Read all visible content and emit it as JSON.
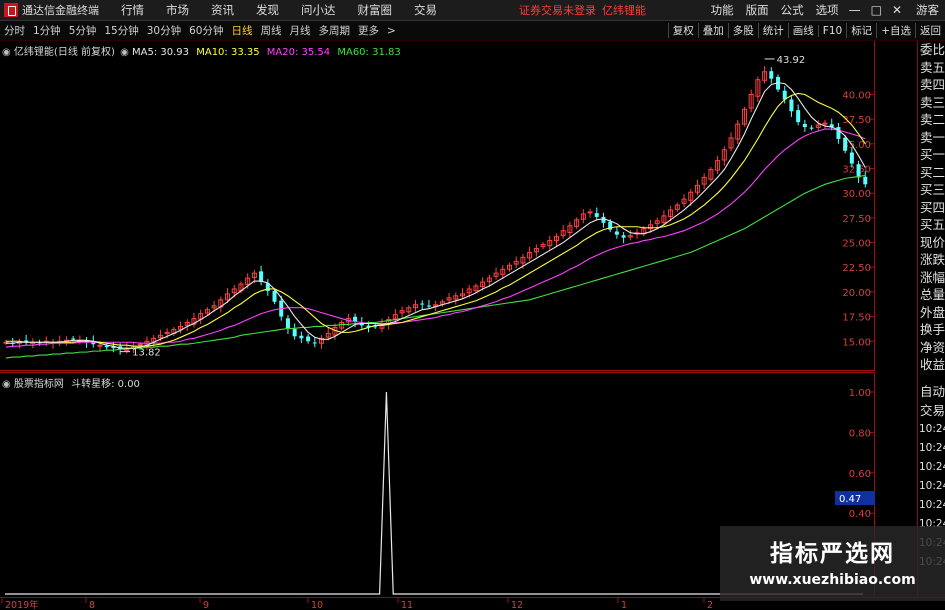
{
  "menubar": {
    "app_title": "通达信金融终端",
    "menus": [
      "行情",
      "市场",
      "资讯",
      "发现",
      "问小达",
      "财富圈",
      "交易"
    ],
    "status_text": "证券交易未登录",
    "stock_name": "亿纬锂能",
    "right_items": [
      "功能",
      "版面",
      "公式",
      "选项"
    ],
    "user": "游客"
  },
  "toolbar": {
    "timeframes": [
      "分时",
      "1分钟",
      "5分钟",
      "15分钟",
      "30分钟",
      "60分钟",
      "日线",
      "周线",
      "月线",
      "多周期",
      "更多"
    ],
    "active": "日线",
    "buttons": [
      "复权",
      "叠加",
      "多股",
      "统计",
      "画线",
      "F10",
      "标记",
      "+自选",
      "返回"
    ]
  },
  "main_legend": {
    "title": "亿纬锂能(日线 前复权)",
    "ma5": "MA5: 30.93",
    "ma10": "MA10: 33.35",
    "ma20": "MA20: 35.54",
    "ma60": "MA60: 31.83"
  },
  "sub_legend": {
    "title": "股票指标网",
    "indicator": "斗转星移: 0.00"
  },
  "right_panel": {
    "items": [
      "委比",
      "卖五",
      "卖四",
      "卖三",
      "卖二",
      "卖一",
      "买一",
      "买二",
      "买三",
      "买四",
      "买五",
      "现价",
      "涨跌",
      "涨幅",
      "总量",
      "外盘",
      "换手",
      "净资",
      "收益"
    ],
    "trade_items": [
      "自动",
      "交易"
    ],
    "times": [
      "10:24",
      "10:24",
      "10:24",
      "10:24",
      "10:24",
      "10:24",
      "10:24",
      "10:24"
    ]
  },
  "date_axis": [
    "2019年",
    "8",
    "9",
    "10",
    "11",
    "12",
    "1",
    "2"
  ],
  "watermark": {
    "line1": "指标严选网",
    "line2": "www.xuezhibiao.com"
  },
  "colors": {
    "up": "#ff4040",
    "down": "#54ffff",
    "ma5": "#e8e8e8",
    "ma10": "#ffff40",
    "ma20": "#ff40ff",
    "ma60": "#40e040",
    "axis": "#a01010"
  },
  "chart_data": [
    {
      "type": "candlestick",
      "title": "亿纬锂能(日线 前复权)",
      "ylim": [
        13,
        44
      ],
      "yticks": [
        15.0,
        17.5,
        20.0,
        22.5,
        25.0,
        27.5,
        30.0,
        32.5,
        35.0,
        37.5,
        40.0
      ],
      "annotations": [
        {
          "label": "43.92",
          "kind": "high"
        },
        {
          "label": "13.82",
          "kind": "low"
        }
      ],
      "close": [
        14.9,
        14.8,
        14.9,
        14.9,
        14.9,
        14.8,
        15.0,
        14.9,
        15.0,
        15.1,
        15.2,
        15.1,
        14.9,
        14.7,
        14.6,
        14.4,
        14.3,
        14.2,
        14.3,
        14.5,
        14.7,
        15.0,
        15.3,
        15.6,
        15.9,
        16.2,
        16.5,
        16.9,
        17.3,
        17.8,
        18.2,
        18.6,
        19.2,
        19.8,
        20.3,
        20.8,
        21.4,
        21.9,
        21.0,
        20.1,
        19.0,
        17.5,
        16.3,
        15.5,
        15.3,
        15.0,
        14.8,
        15.3,
        15.8,
        16.4,
        16.9,
        17.3,
        17.0,
        16.6,
        16.4,
        16.5,
        16.8,
        17.2,
        17.7,
        18.1,
        18.4,
        18.7,
        18.8,
        18.6,
        18.7,
        19.0,
        19.4,
        19.6,
        19.8,
        20.3,
        20.6,
        21.0,
        21.4,
        21.9,
        22.3,
        22.7,
        23.1,
        23.5,
        24.0,
        24.4,
        24.8,
        25.2,
        25.6,
        26.2,
        26.7,
        27.3,
        27.9,
        28.1,
        27.6,
        27.0,
        26.3,
        25.8,
        25.5,
        25.7,
        26.0,
        26.4,
        26.8,
        27.2,
        27.7,
        28.3,
        28.8,
        29.4,
        30.1,
        30.8,
        31.6,
        32.4,
        33.3,
        34.4,
        35.6,
        37.0,
        38.5,
        40.0,
        41.5,
        42.3,
        41.6,
        40.5,
        39.5,
        38.3,
        37.2,
        36.7,
        36.6,
        36.9,
        37.1,
        36.7,
        35.5,
        34.3,
        33.0,
        31.6,
        30.9
      ],
      "ma5": [
        14.8,
        14.8,
        14.9,
        14.9,
        14.9,
        14.9,
        14.9,
        14.9,
        14.9,
        15.0,
        15.1,
        15.1,
        15.1,
        15.0,
        14.8,
        14.6,
        14.5,
        14.3,
        14.3,
        14.3,
        14.4,
        14.6,
        14.9,
        15.2,
        15.5,
        15.8,
        16.1,
        16.5,
        16.8,
        17.2,
        17.6,
        18.1,
        18.5,
        19.0,
        19.6,
        20.1,
        20.6,
        21.1,
        21.1,
        20.9,
        20.3,
        19.4,
        18.5,
        17.5,
        16.7,
        15.9,
        15.4,
        15.2,
        15.2,
        15.5,
        15.9,
        16.3,
        16.7,
        16.8,
        16.8,
        16.8,
        16.7,
        16.8,
        17.0,
        17.3,
        17.6,
        17.9,
        18.2,
        18.3,
        18.5,
        18.7,
        18.9,
        19.1,
        19.3,
        19.6,
        19.9,
        20.3,
        20.6,
        21.0,
        21.4,
        21.8,
        22.2,
        22.6,
        23.0,
        23.4,
        23.8,
        24.2,
        24.6,
        25.0,
        25.5,
        26.0,
        26.5,
        27.0,
        27.3,
        27.4,
        27.2,
        26.9,
        26.4,
        26.0,
        25.9,
        25.9,
        26.1,
        26.4,
        26.8,
        27.3,
        27.8,
        28.3,
        28.9,
        29.5,
        30.2,
        30.9,
        31.6,
        32.4,
        33.5,
        34.7,
        36.0,
        37.5,
        38.9,
        40.3,
        41.0,
        41.2,
        41.1,
        40.5,
        39.6,
        38.6,
        37.7,
        37.1,
        36.8,
        36.7,
        36.4,
        35.8,
        34.9,
        33.8,
        32.6
      ],
      "ma10": [
        15.0,
        15.0,
        15.0,
        14.9,
        14.9,
        14.9,
        14.9,
        14.9,
        14.9,
        14.9,
        14.9,
        15.0,
        15.0,
        15.0,
        14.9,
        14.8,
        14.7,
        14.6,
        14.6,
        14.5,
        14.5,
        14.5,
        14.6,
        14.7,
        14.9,
        15.1,
        15.4,
        15.7,
        16.0,
        16.4,
        16.7,
        17.1,
        17.5,
        17.9,
        18.4,
        18.8,
        19.3,
        19.8,
        20.1,
        20.3,
        20.3,
        20.0,
        19.6,
        19.1,
        18.6,
        18.0,
        17.4,
        16.8,
        16.4,
        16.1,
        15.9,
        15.9,
        16.0,
        16.2,
        16.4,
        16.6,
        16.6,
        16.7,
        16.8,
        16.9,
        17.1,
        17.3,
        17.5,
        17.7,
        17.9,
        18.1,
        18.3,
        18.5,
        18.7,
        18.9,
        19.1,
        19.4,
        19.7,
        20.0,
        20.4,
        20.7,
        21.1,
        21.5,
        21.9,
        22.3,
        22.7,
        23.1,
        23.5,
        23.9,
        24.3,
        24.7,
        25.2,
        25.6,
        26.0,
        26.3,
        26.5,
        26.6,
        26.6,
        26.6,
        26.6,
        26.5,
        26.5,
        26.5,
        26.6,
        26.8,
        27.1,
        27.4,
        27.8,
        28.3,
        28.8,
        29.4,
        30.0,
        30.7,
        31.5,
        32.4,
        33.3,
        34.4,
        35.5,
        36.7,
        37.8,
        38.8,
        39.5,
        39.9,
        40.1,
        40.0,
        39.6,
        39.2,
        38.9,
        38.6,
        38.2,
        37.6,
        36.9,
        36.0,
        35.0
      ],
      "ma20": [
        14.4,
        14.5,
        14.5,
        14.6,
        14.6,
        14.7,
        14.7,
        14.8,
        14.8,
        14.8,
        14.8,
        14.9,
        14.9,
        14.9,
        14.9,
        14.9,
        14.9,
        14.9,
        14.9,
        14.9,
        14.8,
        14.8,
        14.8,
        14.8,
        14.9,
        14.9,
        15.0,
        15.2,
        15.3,
        15.5,
        15.7,
        15.9,
        16.1,
        16.4,
        16.6,
        16.9,
        17.2,
        17.5,
        17.8,
        18.0,
        18.2,
        18.3,
        18.4,
        18.4,
        18.4,
        18.3,
        18.1,
        17.9,
        17.7,
        17.5,
        17.3,
        17.1,
        17.0,
        16.9,
        16.8,
        16.8,
        16.8,
        16.8,
        16.9,
        16.9,
        17.0,
        17.1,
        17.2,
        17.3,
        17.4,
        17.6,
        17.7,
        17.9,
        18.0,
        18.2,
        18.4,
        18.6,
        18.8,
        19.0,
        19.3,
        19.5,
        19.8,
        20.1,
        20.4,
        20.7,
        21.0,
        21.3,
        21.6,
        21.9,
        22.3,
        22.6,
        23.0,
        23.4,
        23.7,
        24.0,
        24.3,
        24.5,
        24.7,
        24.9,
        25.0,
        25.2,
        25.3,
        25.5,
        25.6,
        25.8,
        26.0,
        26.2,
        26.5,
        26.8,
        27.1,
        27.5,
        27.9,
        28.4,
        28.9,
        29.5,
        30.1,
        30.8,
        31.6,
        32.4,
        33.1,
        33.8,
        34.4,
        34.9,
        35.4,
        35.8,
        36.1,
        36.3,
        36.5,
        36.5,
        36.4,
        36.2,
        36.0,
        35.8,
        35.5
      ],
      "ma60": [
        13.3,
        13.4,
        13.4,
        13.5,
        13.5,
        13.6,
        13.6,
        13.7,
        13.7,
        13.8,
        13.8,
        13.9,
        13.9,
        14.0,
        14.0,
        14.1,
        14.1,
        14.2,
        14.2,
        14.3,
        14.3,
        14.4,
        14.4,
        14.5,
        14.5,
        14.6,
        14.7,
        14.7,
        14.8,
        14.9,
        15.0,
        15.1,
        15.2,
        15.3,
        15.4,
        15.6,
        15.7,
        15.8,
        15.9,
        16.0,
        16.1,
        16.2,
        16.3,
        16.3,
        16.4,
        16.4,
        16.5,
        16.5,
        16.6,
        16.6,
        16.7,
        16.7,
        16.8,
        16.8,
        16.9,
        16.9,
        17.0,
        17.1,
        17.2,
        17.3,
        17.4,
        17.5,
        17.6,
        17.7,
        17.8,
        17.9,
        18.0,
        18.1,
        18.2,
        18.3,
        18.4,
        18.5,
        18.6,
        18.7,
        18.8,
        18.9,
        19.0,
        19.1,
        19.2,
        19.4,
        19.6,
        19.8,
        20.0,
        20.2,
        20.4,
        20.6,
        20.8,
        21.0,
        21.2,
        21.4,
        21.6,
        21.8,
        22.0,
        22.2,
        22.4,
        22.6,
        22.8,
        23.0,
        23.2,
        23.4,
        23.6,
        23.8,
        24.0,
        24.3,
        24.6,
        24.9,
        25.2,
        25.5,
        25.8,
        26.1,
        26.4,
        26.8,
        27.2,
        27.6,
        28.0,
        28.4,
        28.8,
        29.2,
        29.6,
        30.0,
        30.3,
        30.6,
        30.9,
        31.1,
        31.3,
        31.5,
        31.6,
        31.7,
        31.8
      ]
    },
    {
      "type": "line",
      "title": "斗转星移",
      "ylim": [
        0,
        1
      ],
      "yticks": [
        0.4,
        0.6,
        0.8,
        1.0
      ],
      "current_label": "0.47",
      "values_note": "flat at 0 except one spike to 1.00",
      "spike_index": 56,
      "points": 127
    }
  ]
}
